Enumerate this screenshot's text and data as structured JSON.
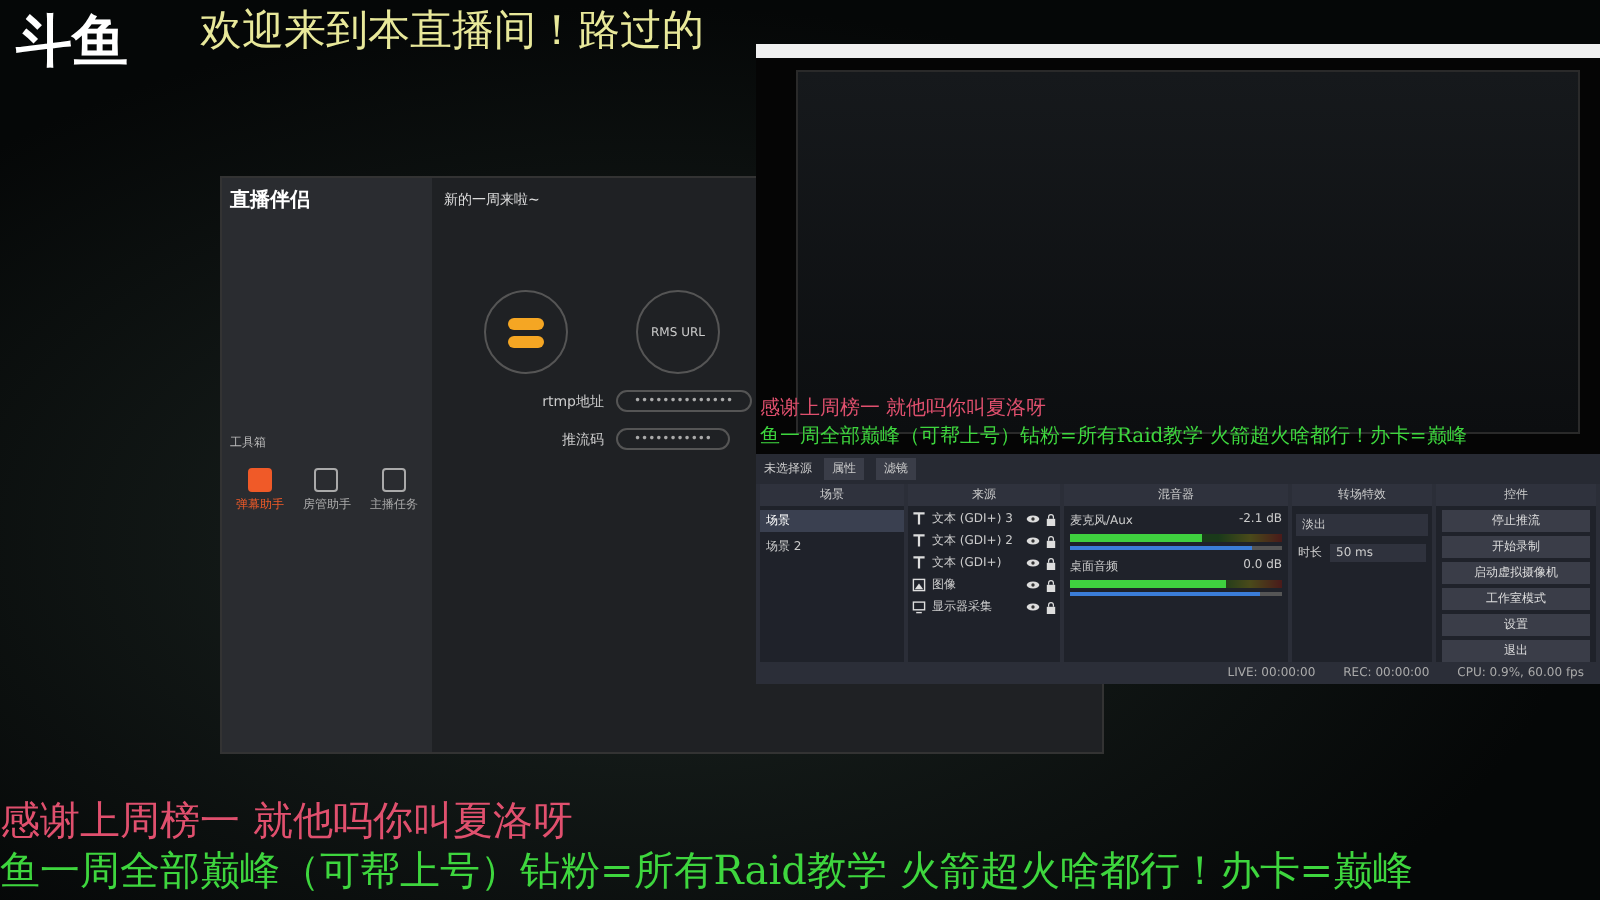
{
  "logo": "斗鱼",
  "banner": "欢迎来到本直播间！路过的",
  "companion": {
    "title": "直播伴侣",
    "heading": "新的一周来啦~",
    "toolbox_title": "工具箱",
    "tools": [
      {
        "label": "弹幕助手",
        "active": true
      },
      {
        "label": "房管助手",
        "active": false
      },
      {
        "label": "主播任务",
        "active": false
      }
    ],
    "step_label": "RMS URL",
    "fields": [
      {
        "label": "rtmp地址",
        "value": "••••••••••••••"
      },
      {
        "label": "推流码",
        "value": "•••••••••••"
      }
    ]
  },
  "obs": {
    "preview_lines": [
      {
        "text": "感谢上周榜一 就他吗你叫夏洛呀",
        "color": "#e0506e"
      },
      {
        "text": "鱼一周全部巅峰（可帮上号）钻粉=所有Raid教学 火箭超火啥都行！办卡=巅峰",
        "color": "#3ed63e"
      }
    ],
    "selection": "未选择源",
    "props_buttons": [
      "属性",
      "滤镜"
    ],
    "docks": [
      "场景",
      "来源",
      "混音器",
      "转场特效",
      "控件"
    ],
    "scenes": [
      {
        "name": "场景",
        "selected": true
      },
      {
        "name": "场景 2",
        "selected": false
      }
    ],
    "sources": [
      {
        "name": "文本 (GDI+) 3",
        "kind": "text"
      },
      {
        "name": "文本 (GDI+) 2",
        "kind": "text"
      },
      {
        "name": "文本 (GDI+)",
        "kind": "text"
      },
      {
        "name": "图像",
        "kind": "image"
      },
      {
        "name": "显示器采集",
        "kind": "display"
      }
    ],
    "mixer": [
      {
        "name": "麦克风/Aux",
        "reading": "-2.1 dB",
        "level": 0.62,
        "fader": {
          "level": 0.86
        }
      },
      {
        "name": "桌面音频",
        "reading": "0.0 dB",
        "level": 0.74,
        "fader": {
          "level": 0.9
        }
      }
    ],
    "transition": {
      "value": "淡出",
      "duration_label": "时长",
      "duration": "50 ms"
    },
    "controls": [
      "停止推流",
      "开始录制",
      "启动虚拟摄像机",
      "工作室模式",
      "设置",
      "退出"
    ],
    "status": [
      "LIVE: 00:00:00",
      "REC: 00:00:00",
      "CPU: 0.9%, 60.00 fps"
    ]
  },
  "overlay_lines": [
    {
      "text": "感谢上周榜一 就他吗你叫夏洛呀",
      "color": "#e0506e"
    },
    {
      "text": "鱼一周全部巅峰（可帮上号）钻粉=所有Raid教学 火箭超火啥都行！办卡=巅峰",
      "color": "#3ed63e"
    }
  ]
}
